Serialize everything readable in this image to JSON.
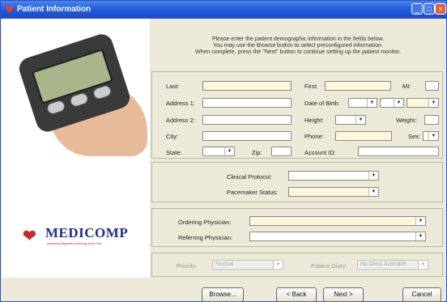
{
  "window": {
    "title": "Patient Information"
  },
  "instructions": [
    "Please enter the patient demographic information in the fields below.",
    "You may use the Browse button to select preconfigured information.",
    "When complete, press the \"Next\" button to continue setting up the patient monitor."
  ],
  "demographics": {
    "last_label": "Last:",
    "first_label": "First:",
    "mi_label": "MI:",
    "address1_label": "Address 1:",
    "address2_label": "Address 2:",
    "city_label": "City:",
    "state_label": "State:",
    "zip_label": "Zip:",
    "dob_label": "Date of Birth:",
    "height_label": "Height:",
    "weight_label": "Weight:",
    "phone_label": "Phone:",
    "sex_label": "Sex:",
    "account_label": "Account ID:"
  },
  "protocol": {
    "clinical_protocol_label": "Clinical Protocol:",
    "pacemaker_status_label": "Pacemaker Status:"
  },
  "physicians": {
    "ordering_label": "Ordering Physician:",
    "referring_label": "Referring Physician:"
  },
  "priority": {
    "priority_label": "Priority:",
    "priority_value": "Normal",
    "diary_label": "Patient Diary:",
    "diary_value": "No Diary Available"
  },
  "logo": {
    "brand": "MEDICOMP",
    "tagline": "advancing diagnostic cardiology since 1981"
  },
  "buttons": {
    "browse": "Browse...",
    "back": "< Back",
    "next": "Next >",
    "cancel": "Cancel"
  },
  "colors": {
    "title_bar": "#245edb",
    "field_fill": "#fdf8dc",
    "brand_blue": "#1e2f8a",
    "brand_red": "#c42b2b"
  }
}
